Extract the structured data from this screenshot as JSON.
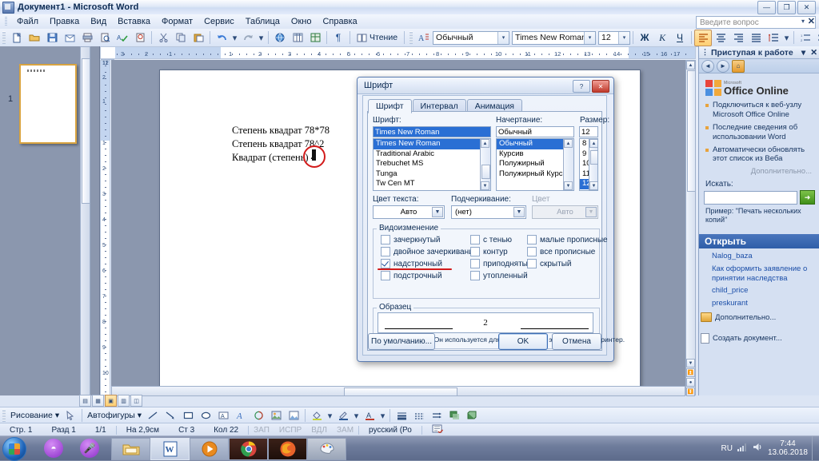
{
  "window": {
    "title": "Документ1 - Microsoft Word",
    "minimize": "—",
    "restore": "❐",
    "close": "✕"
  },
  "menu": {
    "items": [
      "Файл",
      "Правка",
      "Вид",
      "Вставка",
      "Формат",
      "Сервис",
      "Таблица",
      "Окно",
      "Справка"
    ]
  },
  "ask_box": {
    "placeholder": "Введите вопрос",
    "arrow": "▾",
    "close": "✕"
  },
  "toolbar": {
    "read_label": "Чтение",
    "style_value": "Обычный",
    "font_value": "Times New Roman",
    "size_value": "12",
    "bold": "Ж",
    "italic": "К",
    "underline": "Ч",
    "arrow": "▾"
  },
  "ruler": {
    "horizontal_labels": [
      "3",
      "2",
      "1",
      "1",
      "2",
      "3",
      "4",
      "5",
      "6",
      "7",
      "8",
      "9",
      "10",
      "11",
      "12",
      "13",
      "14",
      "15",
      "16",
      "17"
    ],
    "vertical_labels": [
      "2",
      "1",
      "1",
      "2",
      "3",
      "4",
      "5",
      "6",
      "7",
      "8",
      "9",
      "10",
      "11",
      "12"
    ],
    "corner_tab": "L"
  },
  "thumbnails": {
    "page_number": "1"
  },
  "document": {
    "lines": [
      "Степень квадрат 78*78",
      "Степень квадрат 78^2",
      "Квадрат (степень) 4"
    ]
  },
  "task_pane": {
    "title": "Приступая к работе",
    "collapse": "▾",
    "close": "✕",
    "nav": [
      "◄",
      "►",
      "⌂"
    ],
    "logo_small": "Microsoft",
    "logo_text": "Office Online",
    "links": [
      "Подключиться к веб-узлу Microsoft Office Online",
      "Последние сведения об использовании Word",
      "Автоматически обновлять этот список из Веба"
    ],
    "more_label": "Дополнительно...",
    "search_label": "Искать:",
    "search_value": "",
    "search_go": "➜",
    "example_label": "Пример:",
    "example_text": "\"Печать нескольких копий\"",
    "open_section": "Открыть",
    "recent_files": [
      "Nalog_baza",
      "Как оформить заявление о принятии наследства",
      "child_price",
      "preskurant"
    ],
    "open_more": "Дополнительно...",
    "new_document": "Создать документ..."
  },
  "font_dialog": {
    "title": "Шрифт",
    "help_btn": "?",
    "close_btn": "✕",
    "tabs": [
      "Шрифт",
      "Интервал",
      "Анимация"
    ],
    "active_tab": "Шрифт",
    "font_label": "Шрифт:",
    "font_value": "Times New Roman",
    "font_list": [
      "Times New Roman",
      "Traditional Arabic",
      "Trebuchet MS",
      "Tunga",
      "Tw Cen MT"
    ],
    "font_selected": "Times New Roman",
    "style_label": "Начертание:",
    "style_value": "Обычный",
    "style_list": [
      "Обычный",
      "Курсив",
      "Полужирный",
      "Полужирный Курсив"
    ],
    "style_selected": "Обычный",
    "size_label": "Размер:",
    "size_value": "12",
    "size_list": [
      "8",
      "9",
      "10",
      "11",
      "12"
    ],
    "size_selected": "12",
    "text_color_label": "Цвет текста:",
    "text_color_value": "Авто",
    "underline_label": "Подчеркивание:",
    "underline_value": "(нет)",
    "underline_color_label": "Цвет подчеркивания:",
    "underline_color_value": "Авто",
    "effects_label": "Видоизменение",
    "effects": [
      {
        "label": "зачеркнутый",
        "checked": false
      },
      {
        "label": "двойное зачеркивание",
        "checked": false
      },
      {
        "label": "надстрочный",
        "checked": true
      },
      {
        "label": "подстрочный",
        "checked": false
      },
      {
        "label": "с тенью",
        "checked": false
      },
      {
        "label": "контур",
        "checked": false
      },
      {
        "label": "приподнятый",
        "checked": false
      },
      {
        "label": "утопленный",
        "checked": false
      },
      {
        "label": "малые прописные",
        "checked": false
      },
      {
        "label": "все прописные",
        "checked": false
      },
      {
        "label": "скрытый",
        "checked": false
      }
    ],
    "sample_label": "Образец",
    "sample_text": "2",
    "note": "Шрифт TrueType. Он используется для вывода как на экран, так и на принтер.",
    "default_btn": "По умолчанию...",
    "ok_btn": "OK",
    "cancel_btn": "Отмена",
    "accent_selection": "#2a6fd4",
    "annotation_color": "#d21a1a"
  },
  "drawing_toolbar": {
    "draw_label": "Рисование",
    "autoshapes_label": "Автофигуры",
    "arrow": "▾"
  },
  "status_bar": {
    "page": "Стр. 1",
    "section": "Разд 1",
    "pages": "1/1",
    "at": "На 2,9см",
    "line": "Ст 3",
    "column": "Кол 22",
    "modes": [
      "ЗАП",
      "ИСПР",
      "ВДЛ",
      "ЗАМ"
    ],
    "language": "русский (Ро"
  },
  "taskbar": {
    "apps": [
      "explorer",
      "word",
      "media",
      "chrome",
      "firefox",
      "paint"
    ],
    "lang": "RU",
    "time": "7:44",
    "date": "13.06.2018"
  }
}
